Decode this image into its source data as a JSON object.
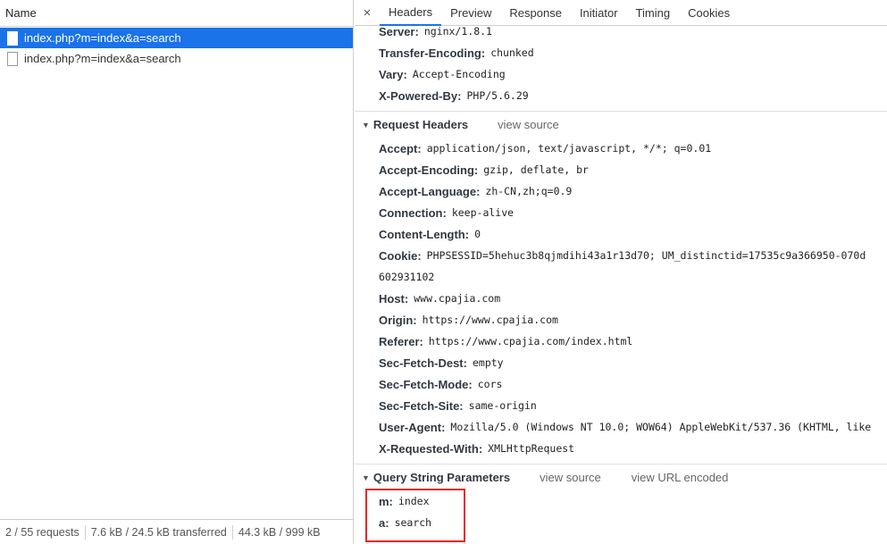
{
  "left": {
    "header": "Name",
    "requests": [
      {
        "name": "index.php?m=index&a=search",
        "selected": true
      },
      {
        "name": "index.php?m=index&a=search",
        "selected": false
      }
    ],
    "status": {
      "requests": "2 / 55 requests",
      "transferred": "7.6 kB / 24.5 kB transferred",
      "resources": "44.3 kB / 999 kB"
    }
  },
  "tabs": {
    "close": "×",
    "items": [
      "Headers",
      "Preview",
      "Response",
      "Initiator",
      "Timing",
      "Cookies"
    ]
  },
  "response_headers": [
    {
      "key": "Server:",
      "value": "nginx/1.8.1"
    },
    {
      "key": "Transfer-Encoding:",
      "value": "chunked"
    },
    {
      "key": "Vary:",
      "value": "Accept-Encoding"
    },
    {
      "key": "X-Powered-By:",
      "value": "PHP/5.6.29"
    }
  ],
  "request_headers": {
    "title": "Request Headers",
    "link": "view source",
    "items": [
      {
        "key": "Accept:",
        "value": "application/json, text/javascript, */*; q=0.01"
      },
      {
        "key": "Accept-Encoding:",
        "value": "gzip, deflate, br"
      },
      {
        "key": "Accept-Language:",
        "value": "zh-CN,zh;q=0.9"
      },
      {
        "key": "Connection:",
        "value": "keep-alive"
      },
      {
        "key": "Content-Length:",
        "value": "0"
      },
      {
        "key": "Cookie:",
        "value": "PHPSESSID=5hehuc3b8qjmdihi43a1r13d70; UM_distinctid=17535c9a366950-070d"
      },
      {
        "key": "",
        "value": "602931102"
      },
      {
        "key": "Host:",
        "value": "www.cpajia.com"
      },
      {
        "key": "Origin:",
        "value": "https://www.cpajia.com"
      },
      {
        "key": "Referer:",
        "value": "https://www.cpajia.com/index.html"
      },
      {
        "key": "Sec-Fetch-Dest:",
        "value": "empty"
      },
      {
        "key": "Sec-Fetch-Mode:",
        "value": "cors"
      },
      {
        "key": "Sec-Fetch-Site:",
        "value": "same-origin"
      },
      {
        "key": "User-Agent:",
        "value": "Mozilla/5.0 (Windows NT 10.0; WOW64) AppleWebKit/537.36 (KHTML, like"
      },
      {
        "key": "X-Requested-With:",
        "value": "XMLHttpRequest"
      }
    ]
  },
  "query_params": {
    "title": "Query String Parameters",
    "link1": "view source",
    "link2": "view URL encoded",
    "items": [
      {
        "key": "m:",
        "value": "index"
      },
      {
        "key": "a:",
        "value": "search"
      }
    ]
  },
  "colors": {
    "accent": "#1a73e8",
    "highlight": "#e5262b"
  }
}
